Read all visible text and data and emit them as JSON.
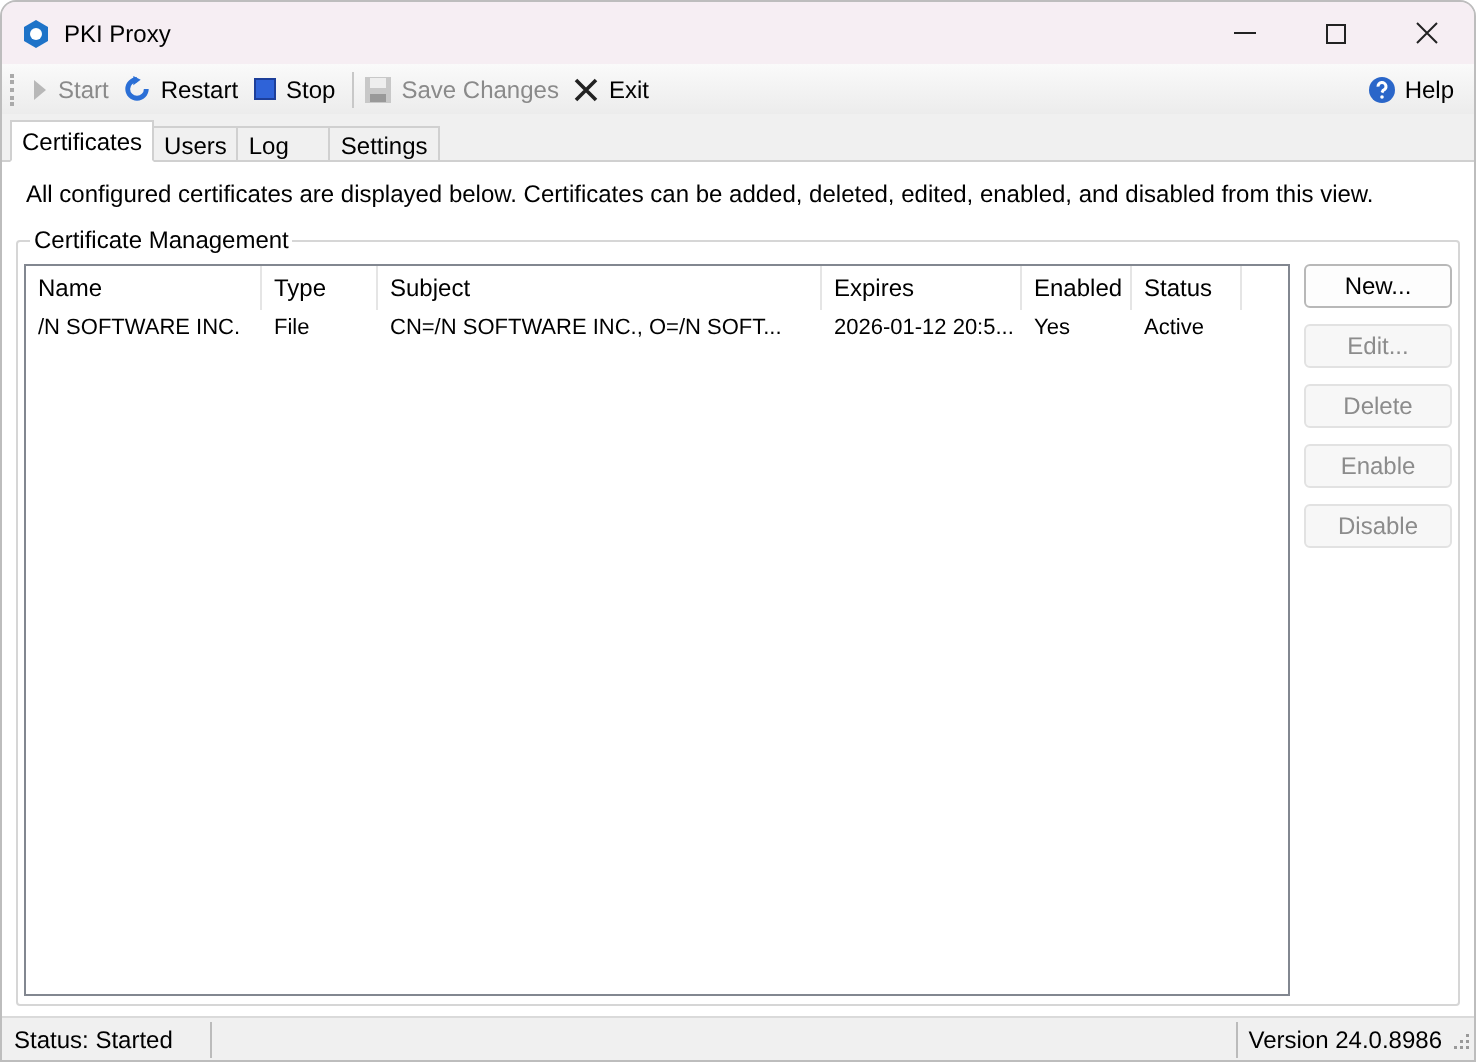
{
  "window": {
    "title": "PKI Proxy"
  },
  "toolbar": [
    {
      "kind": "start",
      "label": "Start",
      "disabled": true
    },
    {
      "kind": "restart",
      "label": "Restart",
      "disabled": false
    },
    {
      "kind": "stop",
      "label": "Stop",
      "disabled": false
    },
    {
      "kind": "save",
      "label": "Save Changes",
      "disabled": true
    },
    {
      "kind": "exit",
      "label": "Exit",
      "disabled": false
    }
  ],
  "help": {
    "label": "Help"
  },
  "tabs": [
    {
      "label": "Certificates",
      "selected": true
    },
    {
      "label": "Users",
      "selected": false
    },
    {
      "label": "Log",
      "selected": false
    },
    {
      "label": "Settings",
      "selected": false
    }
  ],
  "description": "All configured certificates are displayed below. Certificates can be added, deleted, edited, enabled, and disabled from this view.",
  "group": {
    "title": "Certificate Management"
  },
  "table": {
    "columns": [
      "Name",
      "Type",
      "Subject",
      "Expires",
      "Enabled",
      "Status"
    ],
    "rows": [
      [
        "/N SOFTWARE INC.",
        "File",
        "CN=/N SOFTWARE INC., O=/N SOFT...",
        "2026-01-12 20:5...",
        "Yes",
        "Active"
      ]
    ]
  },
  "buttons": [
    {
      "label": "New...",
      "disabled": false
    },
    {
      "label": "Edit...",
      "disabled": true
    },
    {
      "label": "Delete",
      "disabled": true
    },
    {
      "label": "Enable",
      "disabled": true
    },
    {
      "label": "Disable",
      "disabled": true
    }
  ],
  "status_bar": {
    "status": "Status: Started",
    "version": "Version 24.0.8986"
  }
}
